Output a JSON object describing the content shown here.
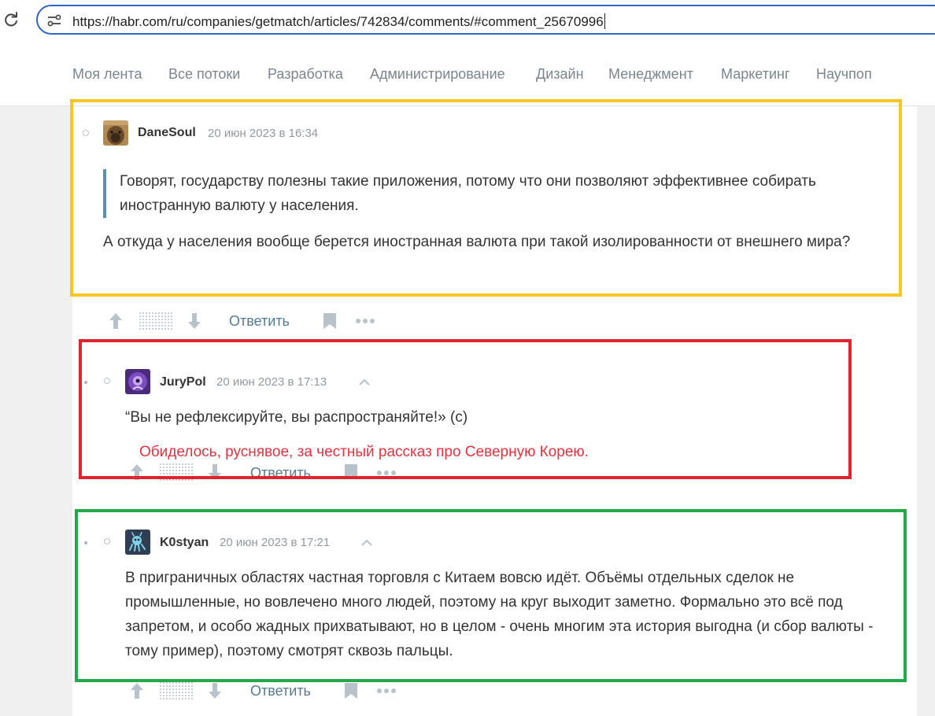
{
  "browser": {
    "url": "https://habr.com/ru/companies/getmatch/articles/742834/comments/#comment_25670996"
  },
  "nav": {
    "items": [
      "Моя лента",
      "Все потоки",
      "Разработка",
      "Администрирование",
      "Дизайн",
      "Менеджмент",
      "Маркетинг",
      "Научпоп"
    ]
  },
  "comments": [
    {
      "author": "DaneSoul",
      "date": "20 июн 2023 в 16:34",
      "quote": "Говорят, государству полезны такие приложения, потому что они позволяют эффективнее собирать иностранную валюту у населения.",
      "text": "А откуда у населения вообще берется иностранная валюта при такой изолированности от внешнего мира?",
      "reply_label": "Ответить"
    },
    {
      "author": "JuryPol",
      "date": "20 июн 2023 в 17:13",
      "text": "“Вы не рефлексируйте, вы распространяйте!» (с)",
      "reply_label": "Ответить"
    },
    {
      "author": "K0styan",
      "date": "20 июн 2023 в 17:21",
      "text": "В приграничных областях частная торговля с Китаем вовсю идёт. Объёмы отдельных сделок не промышленные, но вовлечено много людей, поэтому на круг выходит заметно. Формально это всё под запретом, и особо жадных прихватывают, но в целом - очень многим эта история выгодна (и сбор валюты - тому пример), поэтому смотрят сквозь пальцы.",
      "reply_label": "Ответить"
    }
  ],
  "annotation": {
    "note": "Обиделось, руснявое, за честный рассказ про Северную Корею."
  },
  "colors": {
    "highlight_yellow": "#f6c721",
    "highlight_red": "#e0232e",
    "highlight_green": "#23a94a",
    "link": "#557a96",
    "quote_bar": "#5e8fa8"
  }
}
